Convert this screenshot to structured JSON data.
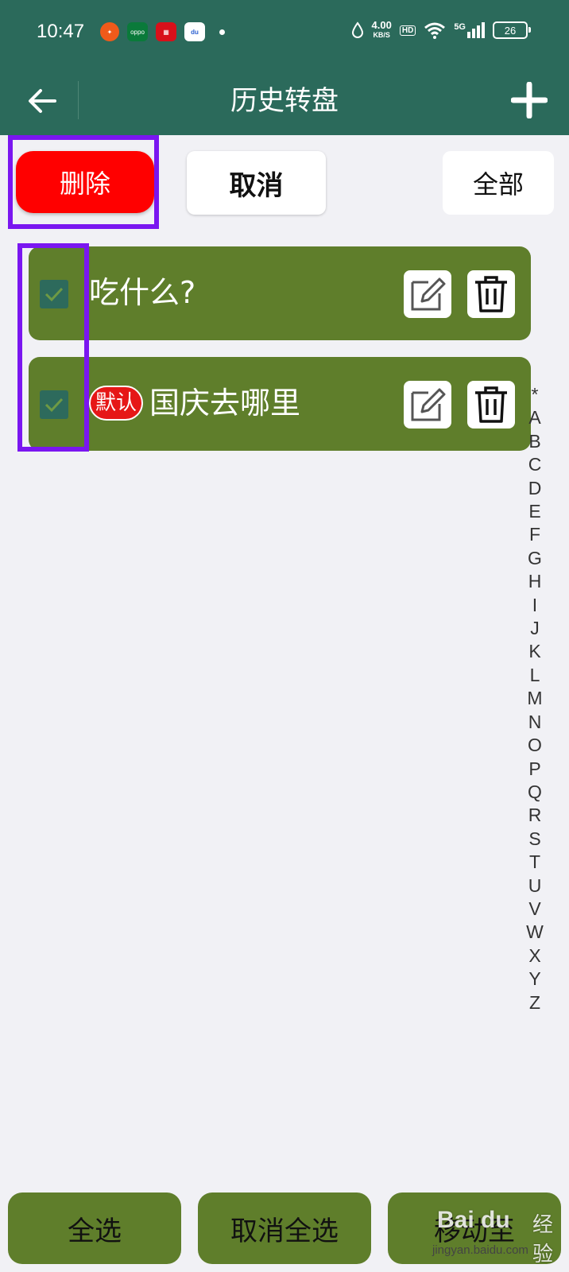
{
  "status_bar": {
    "time": "10:47",
    "net_speed_value": "4.00",
    "net_speed_unit": "KB/S",
    "hd": "HD",
    "network": "5G",
    "battery": "26",
    "app_icons": [
      "oppo-browser-icon",
      "oppo-store-icon",
      "game-center-icon",
      "baidu-icon"
    ]
  },
  "appbar": {
    "title": "历史转盘"
  },
  "toolbar": {
    "delete_label": "删除",
    "cancel_label": "取消",
    "all_label": "全部"
  },
  "items": [
    {
      "title": "吃什么?",
      "checked": true,
      "badge": ""
    },
    {
      "title": "国庆去哪里",
      "checked": true,
      "badge": "默认"
    }
  ],
  "index_letters": [
    "*",
    "A",
    "B",
    "C",
    "D",
    "E",
    "F",
    "G",
    "H",
    "I",
    "J",
    "K",
    "L",
    "M",
    "N",
    "O",
    "P",
    "Q",
    "R",
    "S",
    "T",
    "U",
    "V",
    "W",
    "X",
    "Y",
    "Z"
  ],
  "bottom": {
    "select_all": "全选",
    "deselect_all": "取消全选",
    "third": "移动至"
  },
  "watermark": {
    "brand": "Bai du",
    "jingyan": "经验",
    "url": "jingyan.baidu.com"
  },
  "colors": {
    "header_bg": "#2b6a5b",
    "card_bg": "#5f7e2b",
    "delete_red": "#ff0000",
    "highlight_purple": "#7a16f0",
    "page_bg": "#f1f1f5"
  }
}
